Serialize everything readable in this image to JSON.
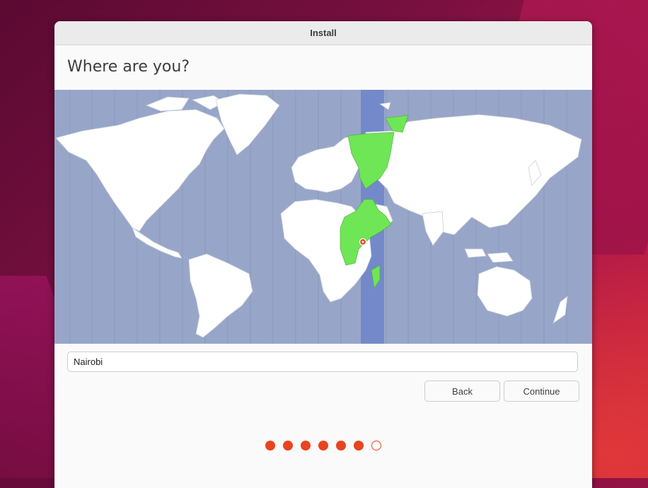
{
  "window": {
    "title": "Install"
  },
  "page": {
    "heading": "Where are you?"
  },
  "map": {
    "selected_timezone_highlight_color": "#6fe655",
    "selected_band_color": "#7389c9",
    "ocean_color": "#97a6c8",
    "land_color": "#ffffff",
    "marker_color": "#e9441f",
    "marker_icon": "location-pin-icon"
  },
  "location_input": {
    "value": "Nairobi"
  },
  "buttons": {
    "back_label": "Back",
    "continue_label": "Continue"
  },
  "progress": {
    "total_steps": 7,
    "completed_steps": 6,
    "accent_color": "#e9441f"
  }
}
